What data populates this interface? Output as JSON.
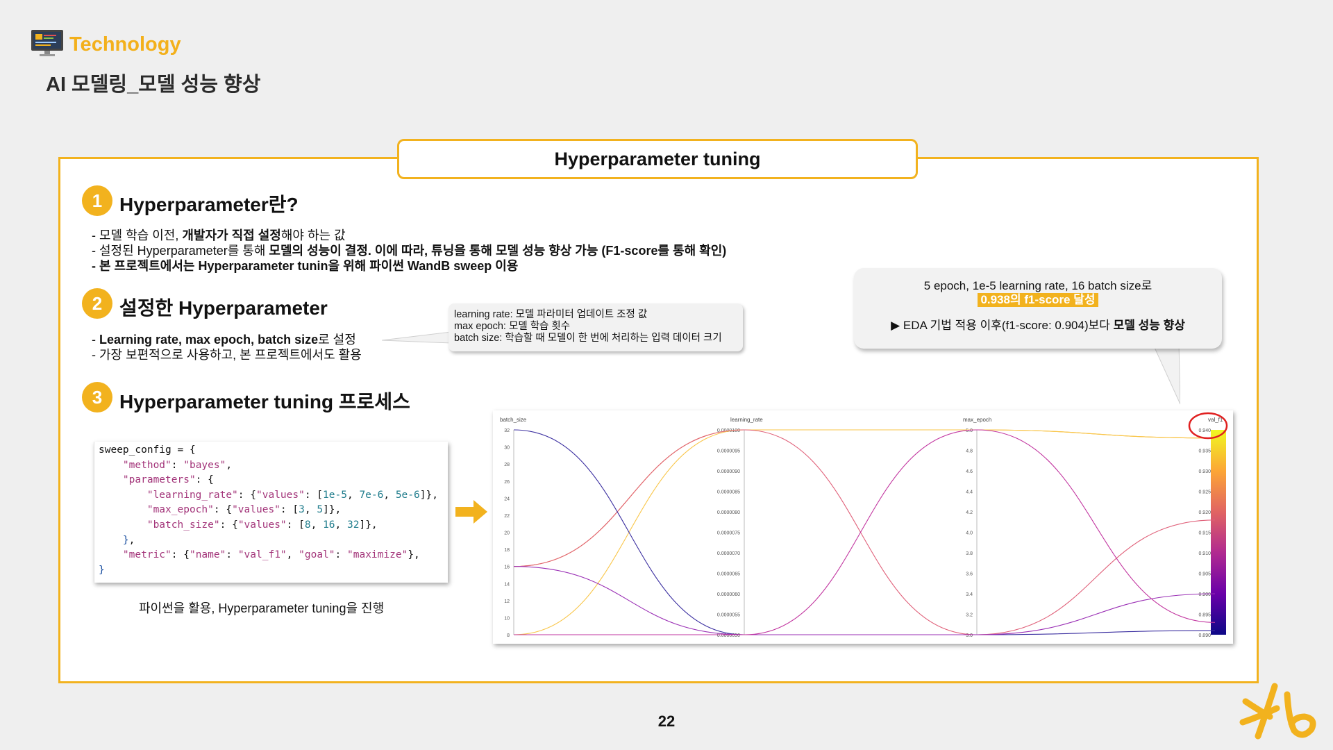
{
  "header": {
    "category": "Technology",
    "title": "AI 모델링_모델 성능 향상"
  },
  "frame_title": "Hyperparameter tuning",
  "sections": [
    {
      "number": "1",
      "title": "Hyperparameter란?",
      "bullets": [
        {
          "pre": "- 모델 학습 이전, ",
          "bold": "개발자가 직접 설정",
          "post": "해야 하는 값"
        },
        {
          "pre": "- 설정된 Hyperparameter를 통해 ",
          "bold": "모델의 성능이 결정. 이에 따라, 튜닝을 통해 모델 성능 향상 가능 (F1-score를 통해 확인)",
          "post": ""
        },
        {
          "pre": "",
          "bold": "- 본 프로젝트에서는 Hyperparameter tunin을 위해 파이썬 WandB sweep 이용",
          "post": ""
        }
      ]
    },
    {
      "number": "2",
      "title": "설정한 Hyperparameter",
      "bullets": [
        {
          "pre": "- ",
          "bold": "Learning rate, max epoch, batch size",
          "post": "로 설정"
        },
        {
          "pre": "- 가장 보편적으로 사용하고, 본 프로젝트에서도 활용",
          "bold": "",
          "post": ""
        }
      ]
    },
    {
      "number": "3",
      "title": "Hyperparameter tuning 프로세스"
    }
  ],
  "callout_small": [
    "learning rate: 모델 파라미터 업데이트 조정 값",
    "max epoch: 모델 학습 횟수",
    "batch size: 학습할 때 모델이 한 번에 처리하는 입력 데이터 크기"
  ],
  "callout_big": {
    "line1": "5 epoch, 1e-5 learning rate, 16 batch size로",
    "highlight": "0.938의 f1-score 달성",
    "line3_pre": "▶ EDA 기법 적용 이후(f1-score: 0.904)보다 ",
    "line3_bold": "모델 성능 향상"
  },
  "code": {
    "l1a": "sweep_config = {",
    "l2k": "\"method\"",
    "l2v": "\"bayes\"",
    "l3k": "\"parameters\"",
    "l4k": "\"learning_rate\"",
    "l4v": "\"values\"",
    "l4n1": "1e-5",
    "l4n2": "7e-6",
    "l4n3": "5e-6",
    "l5k": "\"max_epoch\"",
    "l5v": "\"values\"",
    "l5n1": "3",
    "l5n2": "5",
    "l6k": "\"batch_size\"",
    "l6v": "\"values\"",
    "l6n1": "8",
    "l6n2": "16",
    "l6n3": "32",
    "l8k": "\"metric\"",
    "l8a": "\"name\"",
    "l8b": "\"val_f1\"",
    "l8c": "\"goal\"",
    "l8d": "\"maximize\""
  },
  "caption": "파이썬을 활용, Hyperparameter tuning을 진행",
  "page_number": "22",
  "colors": {
    "accent": "#f2b21e",
    "circle": "#e02020"
  },
  "chart_data": {
    "type": "parallel_coordinates",
    "axes": [
      {
        "name": "batch_size",
        "range": [
          8,
          32
        ],
        "ticks": [
          "32",
          "30",
          "28",
          "26",
          "24",
          "22",
          "20",
          "18",
          "16",
          "14",
          "12",
          "10",
          "8"
        ]
      },
      {
        "name": "learning_rate",
        "range": [
          5e-06,
          1e-05
        ],
        "ticks": [
          "0.0000100",
          "0.0000095",
          "0.0000090",
          "0.0000085",
          "0.0000080",
          "0.0000075",
          "0.0000070",
          "0.0000065",
          "0.0000060",
          "0.0000055",
          "0.0000050"
        ]
      },
      {
        "name": "max_epoch",
        "range": [
          3,
          5
        ],
        "ticks": [
          "5.0",
          "4.8",
          "4.6",
          "4.4",
          "4.2",
          "4.0",
          "3.8",
          "3.6",
          "3.4",
          "3.2",
          "3.0"
        ]
      },
      {
        "name": "val_f1",
        "range": [
          0.89,
          0.94
        ],
        "ticks": [
          "0.940",
          "0.935",
          "0.930",
          "0.925",
          "0.920",
          "0.915",
          "0.910",
          "0.905",
          "0.900",
          "0.895",
          "0.890"
        ]
      }
    ],
    "runs": [
      {
        "values": [
          16,
          1e-05,
          5,
          0.938
        ],
        "color": "#f7b52a"
      },
      {
        "values": [
          8,
          1e-05,
          5,
          0.938
        ],
        "color": "#f9c64a"
      },
      {
        "values": [
          16,
          1e-05,
          3,
          0.918
        ],
        "color": "#e0617a"
      },
      {
        "values": [
          32,
          5e-06,
          3,
          0.891
        ],
        "color": "#3b2fa0"
      },
      {
        "values": [
          16,
          5e-06,
          3,
          0.9
        ],
        "color": "#9a2fb5"
      },
      {
        "values": [
          8,
          5e-06,
          5,
          0.893
        ],
        "color": "#c236a0"
      }
    ],
    "colorbar": [
      "#0d0887",
      "#6a00a8",
      "#b12a90",
      "#e16462",
      "#fca636",
      "#f0f921"
    ]
  }
}
